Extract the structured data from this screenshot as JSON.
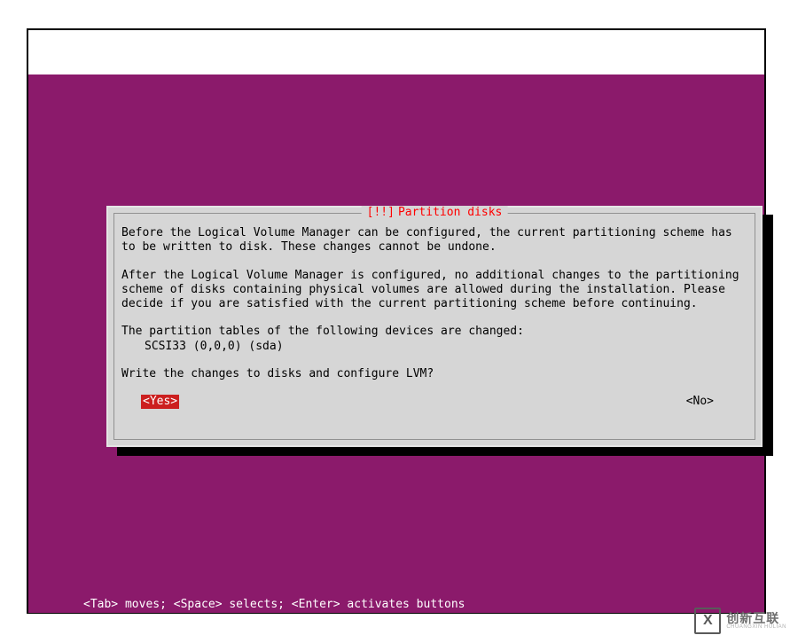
{
  "dialog": {
    "title_prefix": "[!!]",
    "title": "Partition disks",
    "para1": "Before the Logical Volume Manager can be configured, the current partitioning scheme has to be written to disk. These changes cannot be undone.",
    "para2": "After the Logical Volume Manager is configured, no additional changes to the partitioning scheme of disks containing physical volumes are allowed during the installation. Please decide if you are satisfied with the current partitioning scheme before continuing.",
    "para3": "The partition tables of the following devices are changed:",
    "device": "SCSI33 (0,0,0) (sda)",
    "question": "Write the changes to disks and configure LVM?",
    "yes_label": "<Yes>",
    "no_label": "<No>"
  },
  "footer": {
    "help": "<Tab> moves; <Space> selects; <Enter> activates buttons"
  },
  "watermark": {
    "logo_letter": "X",
    "main": "创新互联",
    "sub": "CHUANGXIN HULIAN"
  }
}
